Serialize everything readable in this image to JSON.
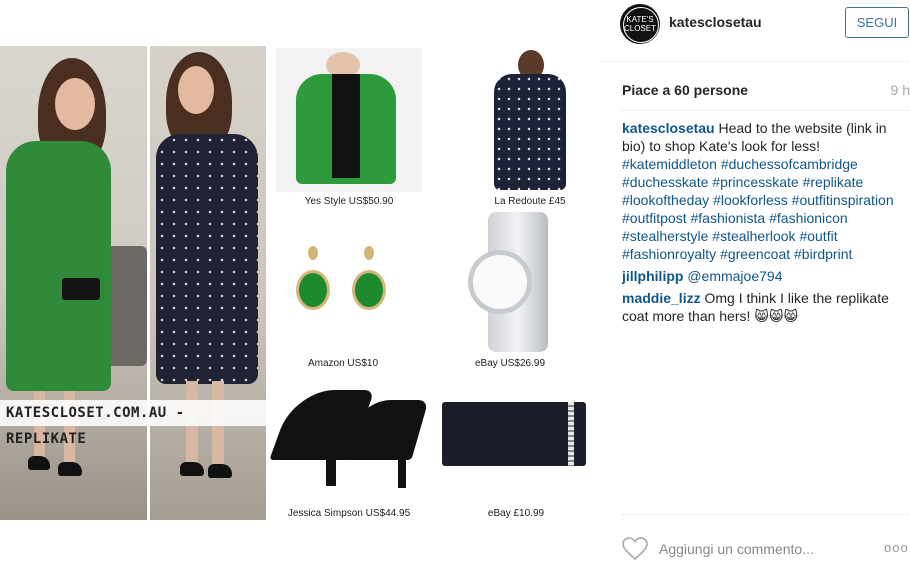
{
  "post_image": {
    "watermark": "KATESCLOSET.COM.AU - REPLIKATE",
    "products": [
      {
        "caption": "Yes Style US$50.90"
      },
      {
        "caption": "La Redoute £45"
      },
      {
        "caption": "Amazon US$10"
      },
      {
        "caption": "eBay US$26.99"
      },
      {
        "caption": "Jessica Simpson US$44.95"
      },
      {
        "caption": "eBay £10.99"
      }
    ]
  },
  "header": {
    "avatar_text": "KATE'S CLOSET",
    "username": "katesclosetau",
    "follow_label": "SEGUI"
  },
  "stats": {
    "likes": "Piace a 60 persone",
    "time": "9 h"
  },
  "comments": {
    "caption_user": "katesclosetau",
    "caption_text": "Head to the website (link in bio) to shop Kate's look for less!",
    "hashtags": [
      "#katemiddleton",
      "#duchessofcambridge",
      "#duchesskate",
      "#princesskate",
      "#replikate",
      "#lookoftheday",
      "#lookforless",
      "#outfitinspiration",
      "#outfitpost",
      "#fashionista",
      "#fashionicon",
      "#stealherstyle",
      "#stealherlook",
      "#outfit",
      "#fashionroyalty",
      "#greencoat",
      "#birdprint"
    ],
    "c2_user": "jillphilipp",
    "c2_text": "@emmajoe794",
    "c3_user": "maddie_lizz",
    "c3_text": "Omg I think I like the replikate coat more than hers! 😸😸😸"
  },
  "footer": {
    "comment_placeholder": "Aggiungi un commento...",
    "more_label": "ooo"
  },
  "colors": {
    "link": "#125688",
    "follow": "#3f729b",
    "coat_green": "#2f8a3a"
  },
  "icons": [
    "heart-icon",
    "more-options-icon"
  ]
}
